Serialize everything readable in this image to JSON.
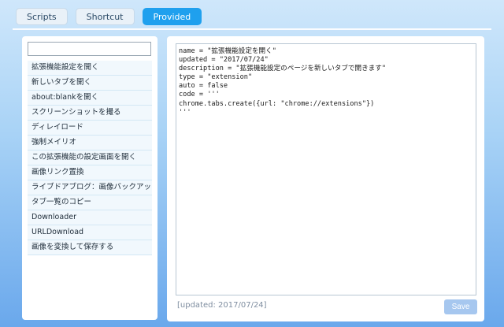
{
  "tabs": [
    {
      "label": "Scripts"
    },
    {
      "label": "Shortcut"
    },
    {
      "label": "Provided"
    }
  ],
  "search": {
    "value": "",
    "placeholder": ""
  },
  "scripts": [
    "拡張機能設定を開く",
    "新しいタブを開く",
    "about:blankを開く",
    "スクリーンショットを撮る",
    "ディレイロード",
    "強制メイリオ",
    "この拡張機能の設定画面を開く",
    "画像リンク置換",
    "ライブドアブログ：画像バックアップ",
    "タブ一覧のコピー",
    "Downloader",
    "URLDownload",
    "画像を変換して保存する"
  ],
  "editor": {
    "content": "name = \"拡張機能設定を開く\"\nupdated = \"2017/07/24\"\ndescription = \"拡張機能設定のページを新しいタブで開きます\"\ntype = \"extension\"\nauto = false\ncode = '''\nchrome.tabs.create({url: \"chrome://extensions\"})\n'''"
  },
  "footer": {
    "updated_text": "[updated: 2017/07/24]",
    "save_label": "Save"
  },
  "colors": {
    "active_tab": "#1fa0ee",
    "save_button": "#a6c7ef"
  }
}
